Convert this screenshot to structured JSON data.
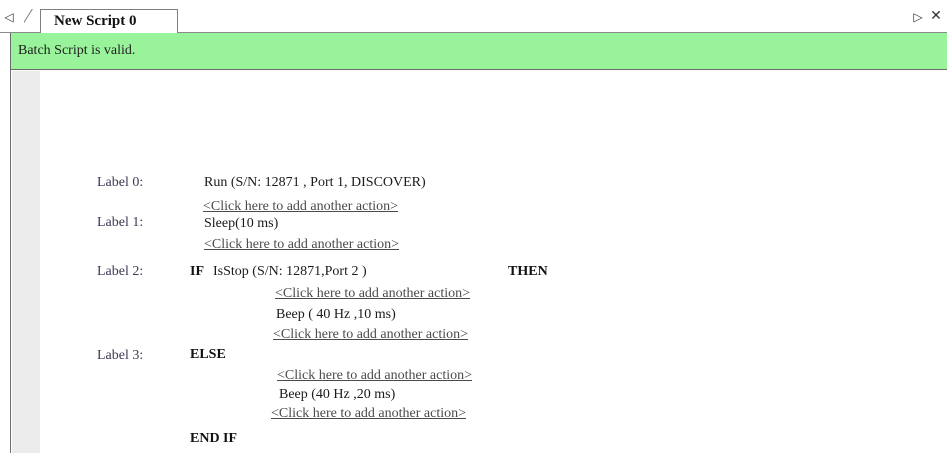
{
  "tabbar": {
    "nav_left_glyph": "◁",
    "tab_title": "New Script 0",
    "nav_right_glyph": "▷",
    "close_glyph": "✕"
  },
  "status": {
    "message": "Batch Script is valid.",
    "color": "#99f39b"
  },
  "script": {
    "labels": [
      "Label 0:",
      "Label 1:",
      "Label 2:",
      "Label 3:"
    ],
    "run_action": "Run (S/N: 12871 , Port 1, DISCOVER)",
    "add_action_link": "<Click here to add another action>",
    "sleep_action": "Sleep(10 ms)",
    "if_keyword": "IF",
    "if_condition": "IsStop (S/N: 12871,Port 2 )",
    "then_keyword": "THEN",
    "beep_then": "Beep ( 40 Hz ,10 ms)",
    "else_keyword": "ELSE",
    "beep_else": "Beep (40 Hz ,20 ms)",
    "endif_keyword": "END IF"
  }
}
